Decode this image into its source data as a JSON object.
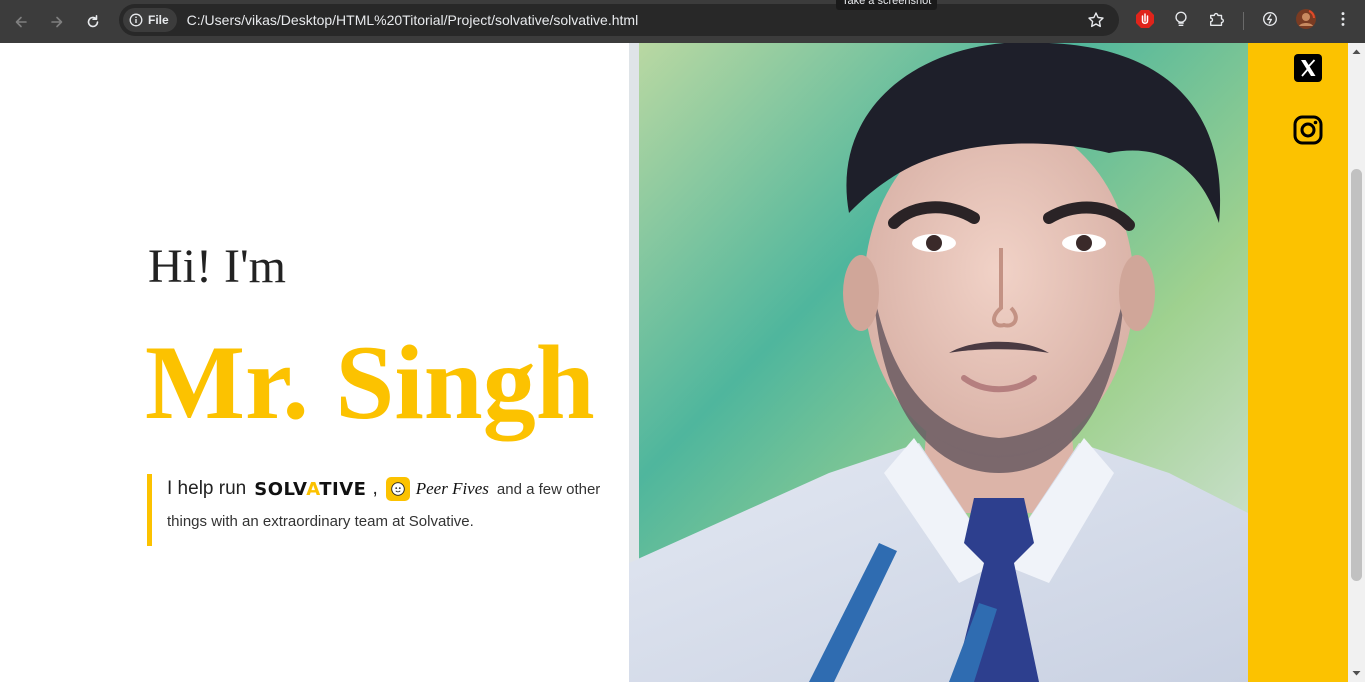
{
  "browser": {
    "file_label": "File",
    "url": "C:/Users/vikas/Desktop/HTML%20Titorial/Project/solvative/solvative.html",
    "tooltip": "Take a screenshot"
  },
  "hero": {
    "greeting": "Hi! I'm",
    "name": "Mr. Singh",
    "intro_prefix": "I help run",
    "solvative_logo_text": "SOLVATIVE",
    "comma": ",",
    "peer_fives_text": "Peer Fives",
    "intro_suffix": "and a few other",
    "intro_line2": "things with an extraordinary team at Solvative."
  },
  "social": {
    "items": [
      "x-icon",
      "instagram-icon"
    ]
  },
  "colors": {
    "accent": "#fcc200",
    "chrome": "#3c3c3c",
    "omnibox": "#282828"
  }
}
